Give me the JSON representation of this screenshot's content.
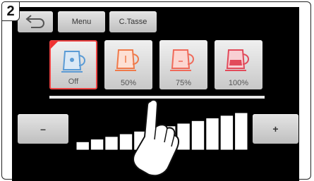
{
  "step_number": "2",
  "header": {
    "menu_label": "Menu",
    "ctasse_label": "C.Tasse"
  },
  "cups": [
    {
      "label": "Off",
      "color": "#5b9bd5",
      "selected": true
    },
    {
      "label": "50%",
      "color": "#f07a4a",
      "selected": false
    },
    {
      "label": "75%",
      "color": "#f06a5a",
      "selected": false
    },
    {
      "label": "100%",
      "color": "#e24a5a",
      "selected": false
    }
  ],
  "controls": {
    "minus_label": "–",
    "plus_label": "+"
  },
  "level": {
    "segments_total": 12,
    "segments_shown": 12
  },
  "colors": {
    "screen_bg": "#000000",
    "button_bg": "#d6d6d6",
    "selected_border": "#e44444"
  }
}
